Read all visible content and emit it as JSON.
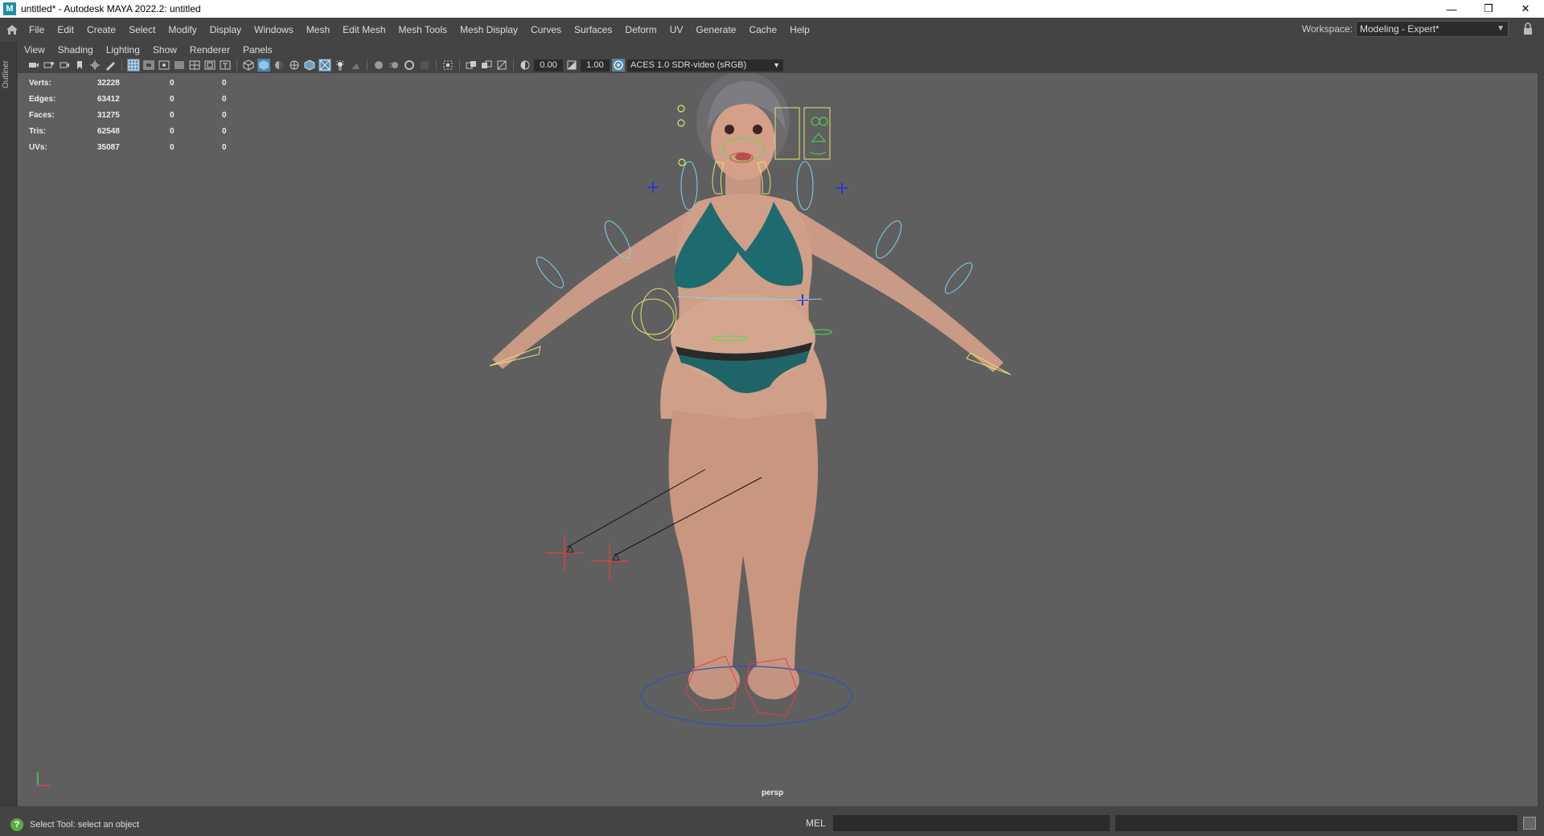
{
  "window": {
    "title": "untitled* - Autodesk MAYA 2022.2: untitled",
    "app_icon": "M",
    "minimize": "—",
    "restore": "❐",
    "close": "✕"
  },
  "menu": [
    "File",
    "Edit",
    "Create",
    "Select",
    "Modify",
    "Display",
    "Windows",
    "Mesh",
    "Edit Mesh",
    "Mesh Tools",
    "Mesh Display",
    "Curves",
    "Surfaces",
    "Deform",
    "UV",
    "Generate",
    "Cache",
    "Help"
  ],
  "workspace": {
    "label": "Workspace:",
    "value": "Modeling - Expert*",
    "arrow": "▼"
  },
  "outliner_tab": "Outliner",
  "panel_menu": [
    "View",
    "Shading",
    "Lighting",
    "Show",
    "Renderer",
    "Panels"
  ],
  "toolbar": {
    "exposure": "0.00",
    "gamma": "1.00",
    "color_space": "ACES 1.0 SDR-video (sRGB)",
    "arrow": "▼"
  },
  "hud": [
    {
      "label": "Verts:",
      "value": "32228",
      "a": "0",
      "b": "0"
    },
    {
      "label": "Edges:",
      "value": "63412",
      "a": "0",
      "b": "0"
    },
    {
      "label": "Faces:",
      "value": "31275",
      "a": "0",
      "b": "0"
    },
    {
      "label": "Tris:",
      "value": "62548",
      "a": "0",
      "b": "0"
    },
    {
      "label": "UVs:",
      "value": "35087",
      "a": "0",
      "b": "0"
    }
  ],
  "camera_label": "persp",
  "status": {
    "help_icon": "?",
    "help_text": "Select Tool: select an object",
    "mel_label": "MEL"
  },
  "colors": {
    "viewport": "#5f5f5f",
    "ui": "#444444",
    "highlight": "#5285a6",
    "skin": "#cf9f88",
    "bikini": "#1d6b6e"
  }
}
